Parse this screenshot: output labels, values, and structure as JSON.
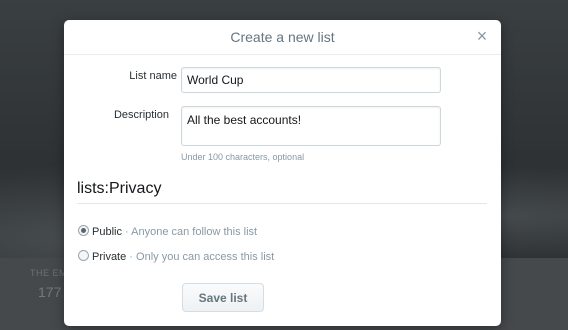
{
  "background": {
    "label": "THE EM",
    "count": "177"
  },
  "dialog": {
    "title": "Create a new list",
    "close_glyph": "×",
    "list_name": {
      "label": "List name",
      "value": "World Cup"
    },
    "description": {
      "label": "Description",
      "value": "All the best accounts!",
      "hint": "Under 100 characters, optional"
    },
    "privacy": {
      "title": "lists:Privacy",
      "options": [
        {
          "label": "Public",
          "description": " · Anyone can follow this list",
          "checked": true
        },
        {
          "label": "Private",
          "description": " · Only you can access this list",
          "checked": false
        }
      ]
    },
    "save_label": "Save list"
  },
  "icons": {
    "close": "close-icon"
  },
  "colors": {
    "overlay": "#2f3336",
    "modal_bg": "#ffffff",
    "muted_text": "#8899a6",
    "border": "#ccd6dd"
  }
}
